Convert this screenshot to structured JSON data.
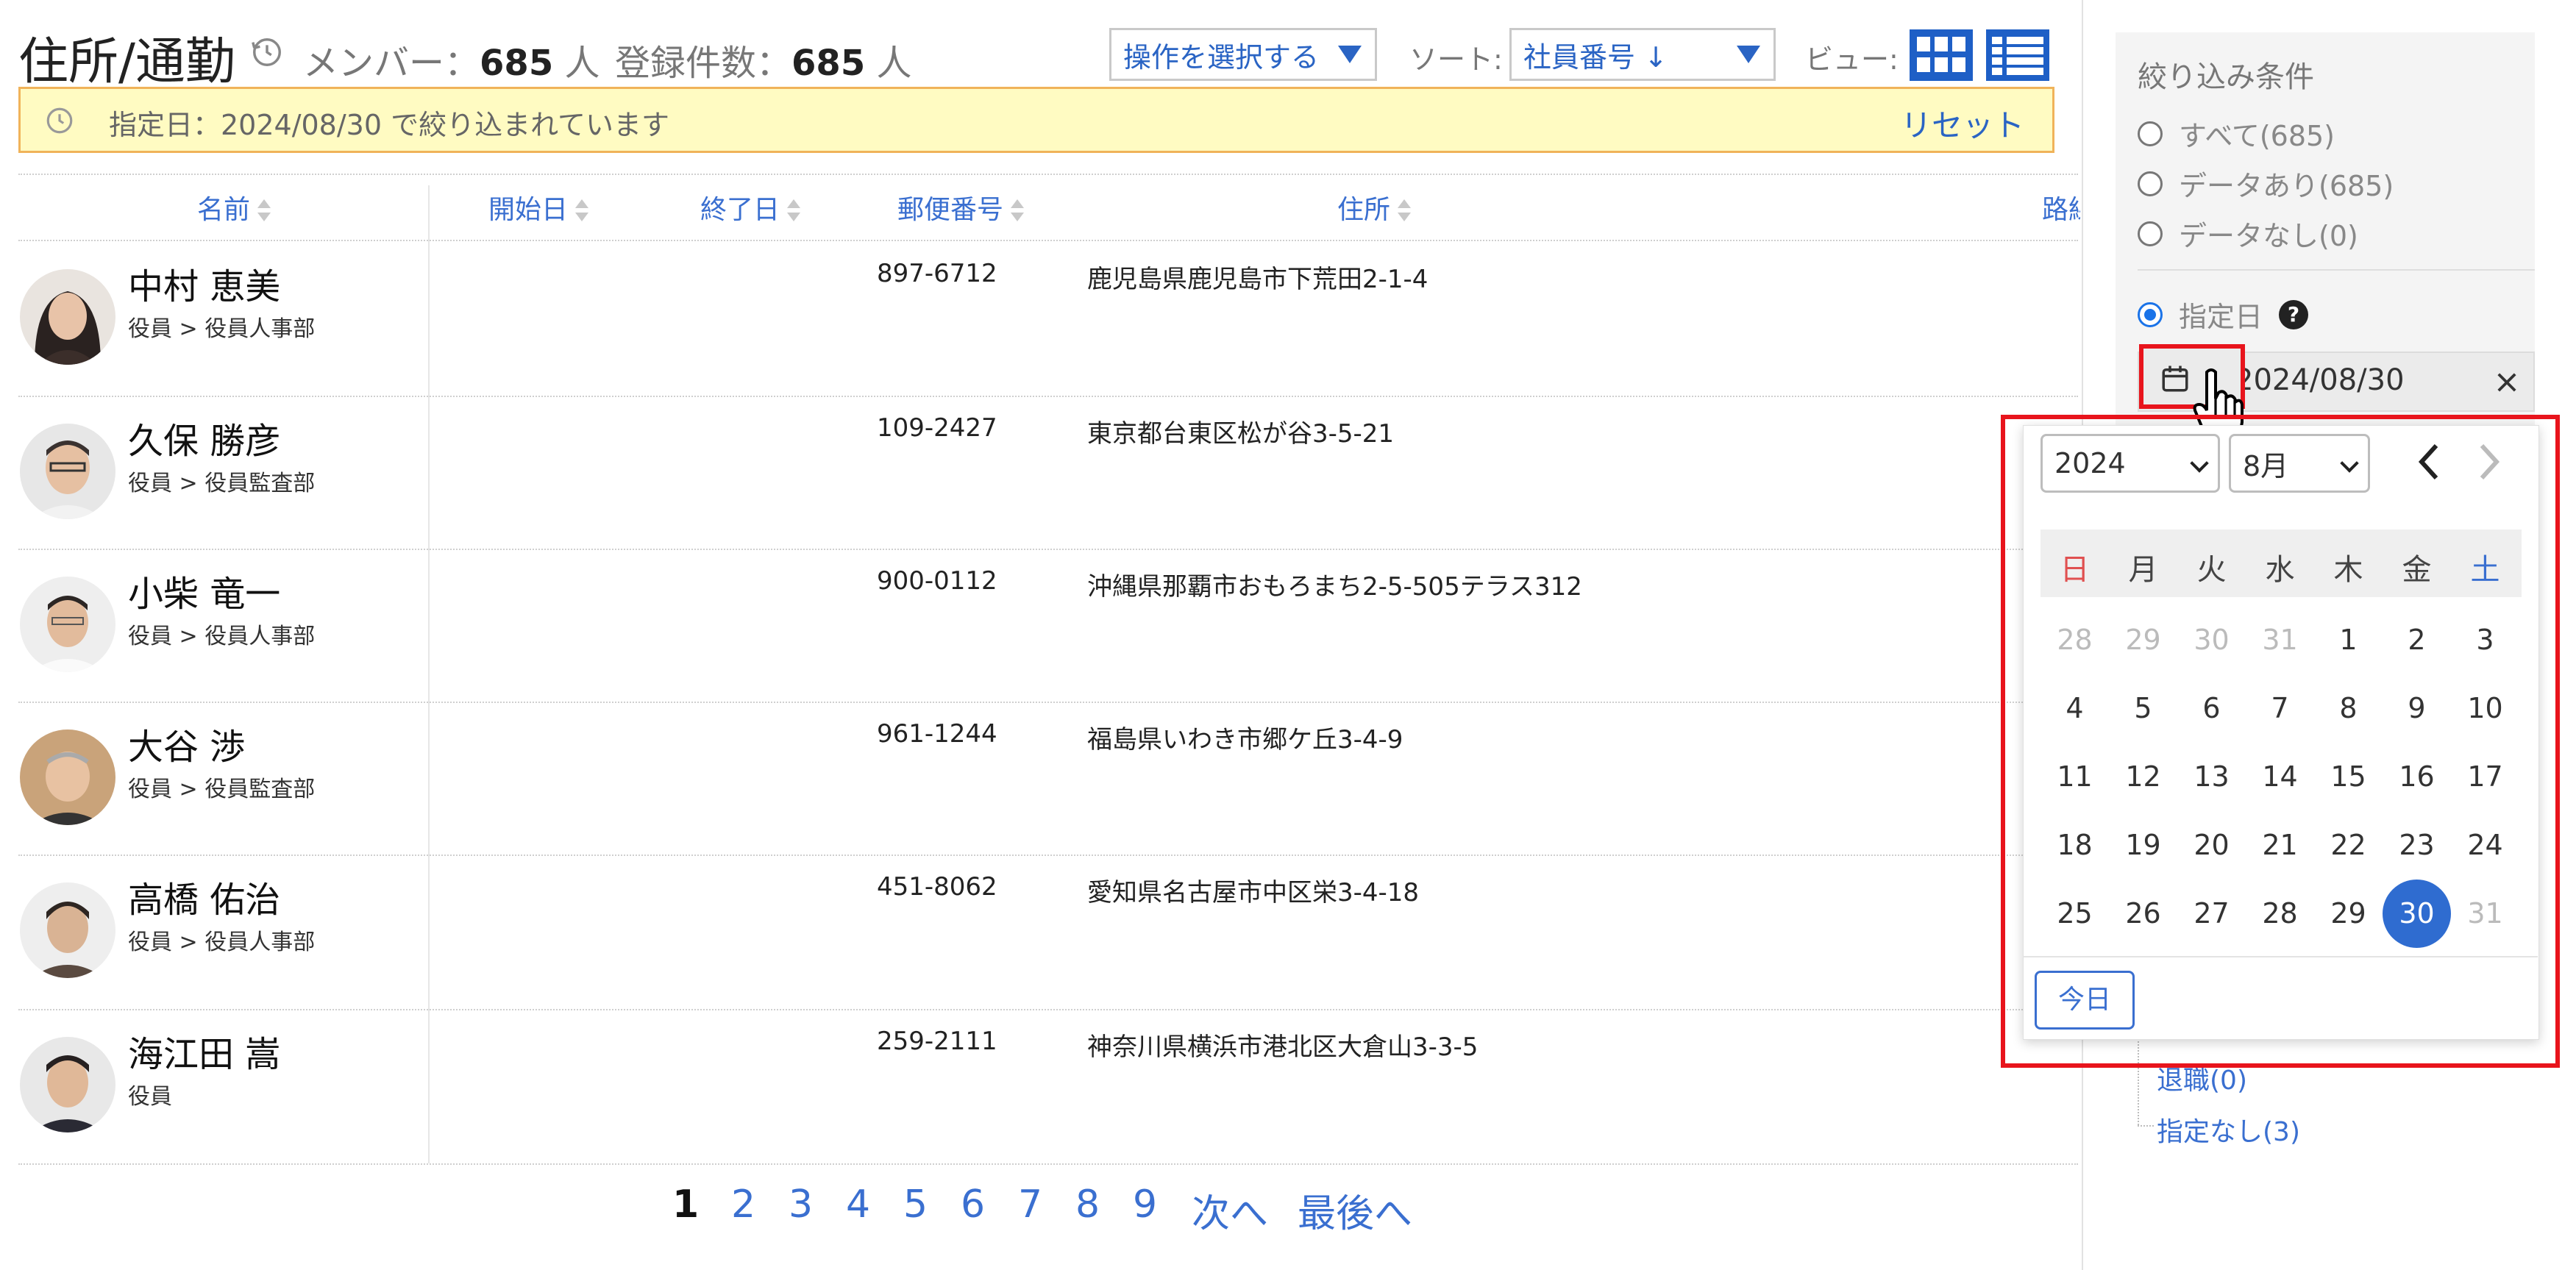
{
  "header": {
    "title": "住所/通勤",
    "members_label": "メンバー：",
    "members_count": "685",
    "members_unit": "人",
    "records_label": "登録件数：",
    "records_count": "685",
    "records_unit": "人",
    "operation_select": "操作を選択する",
    "sort_label": "ソート:",
    "sort_value": "社員番号 ↓",
    "view_label": "ビュー:"
  },
  "banner": {
    "text": "指定日：2024/08/30 で絞り込まれています",
    "reset": "リセット"
  },
  "table": {
    "columns": [
      "名前",
      "開始日",
      "終了日",
      "郵便番号",
      "住所",
      "路線"
    ],
    "rows": [
      {
        "name": "中村 恵美",
        "dept": "役員 > 役員人事部",
        "postal": "897-6712",
        "address": "鹿児島県鹿児島市下荒田2-1-4"
      },
      {
        "name": "久保 勝彦",
        "dept": "役員 > 役員監査部",
        "postal": "109-2427",
        "address": "東京都台東区松が谷3-5-21"
      },
      {
        "name": "小柴 竜一",
        "dept": "役員 > 役員人事部",
        "postal": "900-0112",
        "address": "沖縄県那覇市おもろまち2-5-505テラス312"
      },
      {
        "name": "大谷 渉",
        "dept": "役員 > 役員監査部",
        "postal": "961-1244",
        "address": "福島県いわき市郷ケ丘3-4-9"
      },
      {
        "name": "高橋 佑治",
        "dept": "役員 > 役員人事部",
        "postal": "451-8062",
        "address": "愛知県名古屋市中区栄3-4-18"
      },
      {
        "name": "海江田 嵩",
        "dept": "役員",
        "postal": "259-2111",
        "address": "神奈川県横浜市港北区大倉山3-3-5"
      }
    ]
  },
  "pagination": {
    "pages": [
      "1",
      "2",
      "3",
      "4",
      "5",
      "6",
      "7",
      "8",
      "9"
    ],
    "current": "1",
    "next": "次へ",
    "last": "最後へ"
  },
  "filter": {
    "title": "絞り込み条件",
    "options": [
      "すべて(685)",
      "データあり(685)",
      "データなし(0)"
    ],
    "date_option": "指定日",
    "help": "?",
    "date_value": "2024/08/30",
    "tree_items": [
      "退職(0)",
      "指定なし(3)"
    ]
  },
  "calendar": {
    "year": "2024",
    "month": "8月",
    "weekdays": [
      "日",
      "月",
      "火",
      "水",
      "木",
      "金",
      "土"
    ],
    "weeks": [
      [
        "28",
        "29",
        "30",
        "31",
        "1",
        "2",
        "3"
      ],
      [
        "4",
        "5",
        "6",
        "7",
        "8",
        "9",
        "10"
      ],
      [
        "11",
        "12",
        "13",
        "14",
        "15",
        "16",
        "17"
      ],
      [
        "18",
        "19",
        "20",
        "21",
        "22",
        "23",
        "24"
      ],
      [
        "25",
        "26",
        "27",
        "28",
        "29",
        "30",
        "31"
      ]
    ],
    "selected": "30",
    "today_label": "今日"
  },
  "colors": {
    "accent": "#1e5fc6",
    "link": "#3a6fd0",
    "highlight": "#e8141c",
    "banner_bg": "#fffbc2",
    "banner_border": "#f0b35a",
    "sunday": "#e05050",
    "saturday": "#3a6fd0"
  }
}
